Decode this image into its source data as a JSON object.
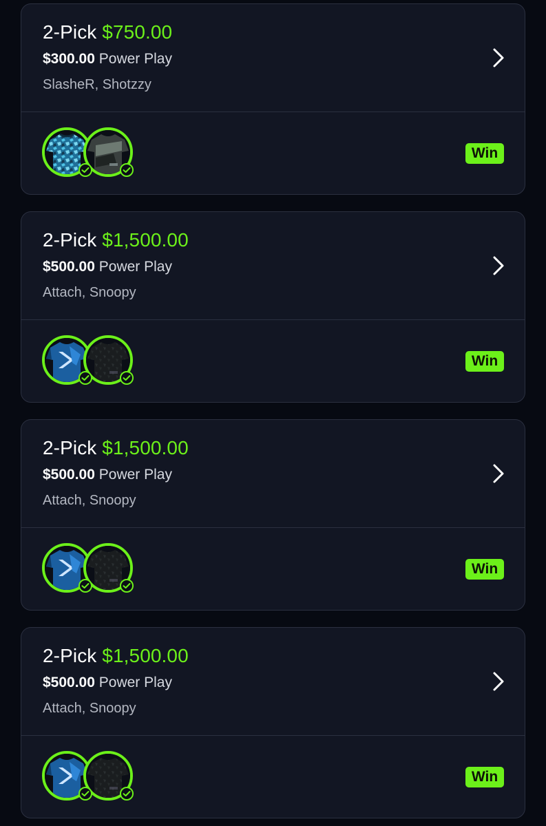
{
  "lineups": [
    {
      "pick_label": "2-Pick",
      "payout": "$750.00",
      "entry_amount": "$300.00",
      "play_type": "Power Play",
      "players": "SlasheR, Shotzzy",
      "jerseys": [
        "light-blue-camo-jersey",
        "dark-gray-green-jersey"
      ],
      "status": "Win"
    },
    {
      "pick_label": "2-Pick",
      "payout": "$1,500.00",
      "entry_amount": "$500.00",
      "play_type": "Power Play",
      "players": "Attach, Snoopy",
      "jerseys": [
        "blue-chevron-jersey",
        "black-camo-jersey"
      ],
      "status": "Win"
    },
    {
      "pick_label": "2-Pick",
      "payout": "$1,500.00",
      "entry_amount": "$500.00",
      "play_type": "Power Play",
      "players": "Attach, Snoopy",
      "jerseys": [
        "blue-chevron-jersey",
        "black-camo-jersey"
      ],
      "status": "Win"
    },
    {
      "pick_label": "2-Pick",
      "payout": "$1,500.00",
      "entry_amount": "$500.00",
      "play_type": "Power Play",
      "players": "Attach, Snoopy",
      "jerseys": [
        "blue-chevron-jersey",
        "black-camo-jersey"
      ],
      "status": "Win"
    }
  ],
  "colors": {
    "background": "#070a12",
    "card": "#121623",
    "border": "#2b3040",
    "accent_green": "#6cf01a",
    "text_primary": "#ffffff",
    "text_secondary": "#b4b8c2"
  },
  "icons": {
    "chevron": "chevron-right-icon",
    "check": "check-circle-icon"
  }
}
